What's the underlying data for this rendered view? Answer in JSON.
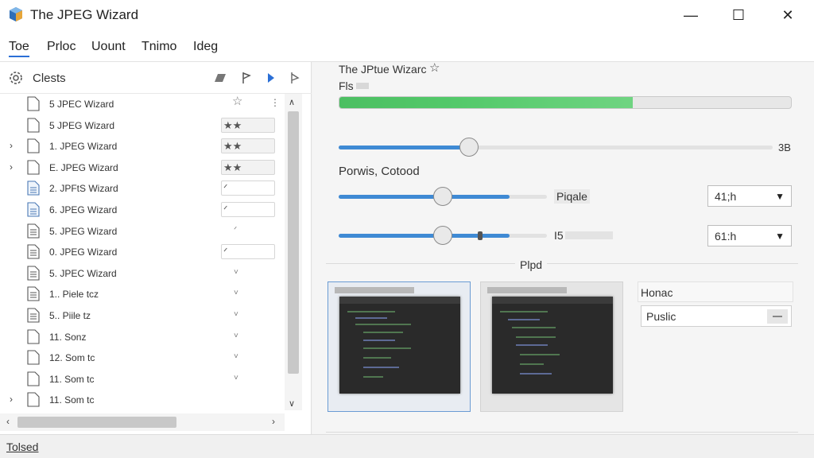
{
  "window": {
    "title": "The JPEG Wizard",
    "minimize": "—",
    "maximize": "☐",
    "close": "✕"
  },
  "menu": [
    "Toe",
    "Prloc",
    "Uount",
    "Tnimo",
    "Ideg"
  ],
  "left_panel": {
    "header": "Clests",
    "tools": [
      "stamp-icon",
      "flag-icon",
      "play-icon",
      "pin-icon"
    ],
    "rows": [
      {
        "chev": "",
        "icon": "file-icon",
        "name": "5 JPEC Wizard",
        "rating": "☆",
        "style": "star"
      },
      {
        "chev": "",
        "icon": "file-icon",
        "name": "5 JPEG Wizard",
        "rating": "★★",
        "style": "grey"
      },
      {
        "chev": "›",
        "icon": "file-icon",
        "name": "1. JPEG Wizard",
        "rating": "★★",
        "style": "grey"
      },
      {
        "chev": "›",
        "icon": "file-icon",
        "name": "E. JPEG Wizard",
        "rating": "★★",
        "style": "grey"
      },
      {
        "chev": "",
        "icon": "file-lines-icon",
        "name": "2. JPFtS Wizard",
        "rating": "ᐟ",
        "style": "white"
      },
      {
        "chev": "",
        "icon": "file-lines-icon",
        "name": "6. JPEG Wizard",
        "rating": "ᐟ",
        "style": "white"
      },
      {
        "chev": "",
        "icon": "doc-lines-icon",
        "name": "5. JPEG Wizard",
        "rating": "ᐟ",
        "style": "none"
      },
      {
        "chev": "",
        "icon": "doc-lines-icon",
        "name": "0. JPEG Wizard",
        "rating": "ᐟ",
        "style": "white"
      },
      {
        "chev": "",
        "icon": "doc-lines-icon",
        "name": "5. JPEC Wizard",
        "rating": "˅",
        "style": "none"
      },
      {
        "chev": "",
        "icon": "doc-lines-icon",
        "name": "1.. Piele tcz",
        "rating": "˅",
        "style": "none"
      },
      {
        "chev": "",
        "icon": "doc-lines-icon",
        "name": "5.. Piile tz",
        "rating": "˅",
        "style": "none"
      },
      {
        "chev": "",
        "icon": "file-icon",
        "name": "11. Sonz",
        "rating": "˅",
        "style": "none"
      },
      {
        "chev": "",
        "icon": "file-icon",
        "name": "12. Som tc",
        "rating": "˅",
        "style": "none"
      },
      {
        "chev": "",
        "icon": "file-icon",
        "name": "11. Som tc",
        "rating": "˅",
        "style": "none"
      },
      {
        "chev": "›",
        "icon": "file-icon",
        "name": "11. Som tc",
        "rating": "",
        "style": "none"
      }
    ]
  },
  "status": {
    "text": "Tolsed"
  },
  "right_panel": {
    "title": "The JPtue Wizarc",
    "subtitle": "Fls",
    "progress": 0.65,
    "slider1": {
      "value": 0.3,
      "readout": "3B"
    },
    "section": "Porwis, Cotood",
    "slider2": {
      "value": 0.5,
      "label": "Piqale",
      "dropdown": "41;h"
    },
    "slider3": {
      "value": 0.5,
      "label": "I5",
      "dropdown": "61:h"
    },
    "divider_label": "Plpd",
    "field_label": "Honac",
    "field_value": "Puslic"
  },
  "colors": {
    "accent": "#2b6fd6",
    "progress": "#53c96a",
    "slider": "#3f8ad4"
  }
}
